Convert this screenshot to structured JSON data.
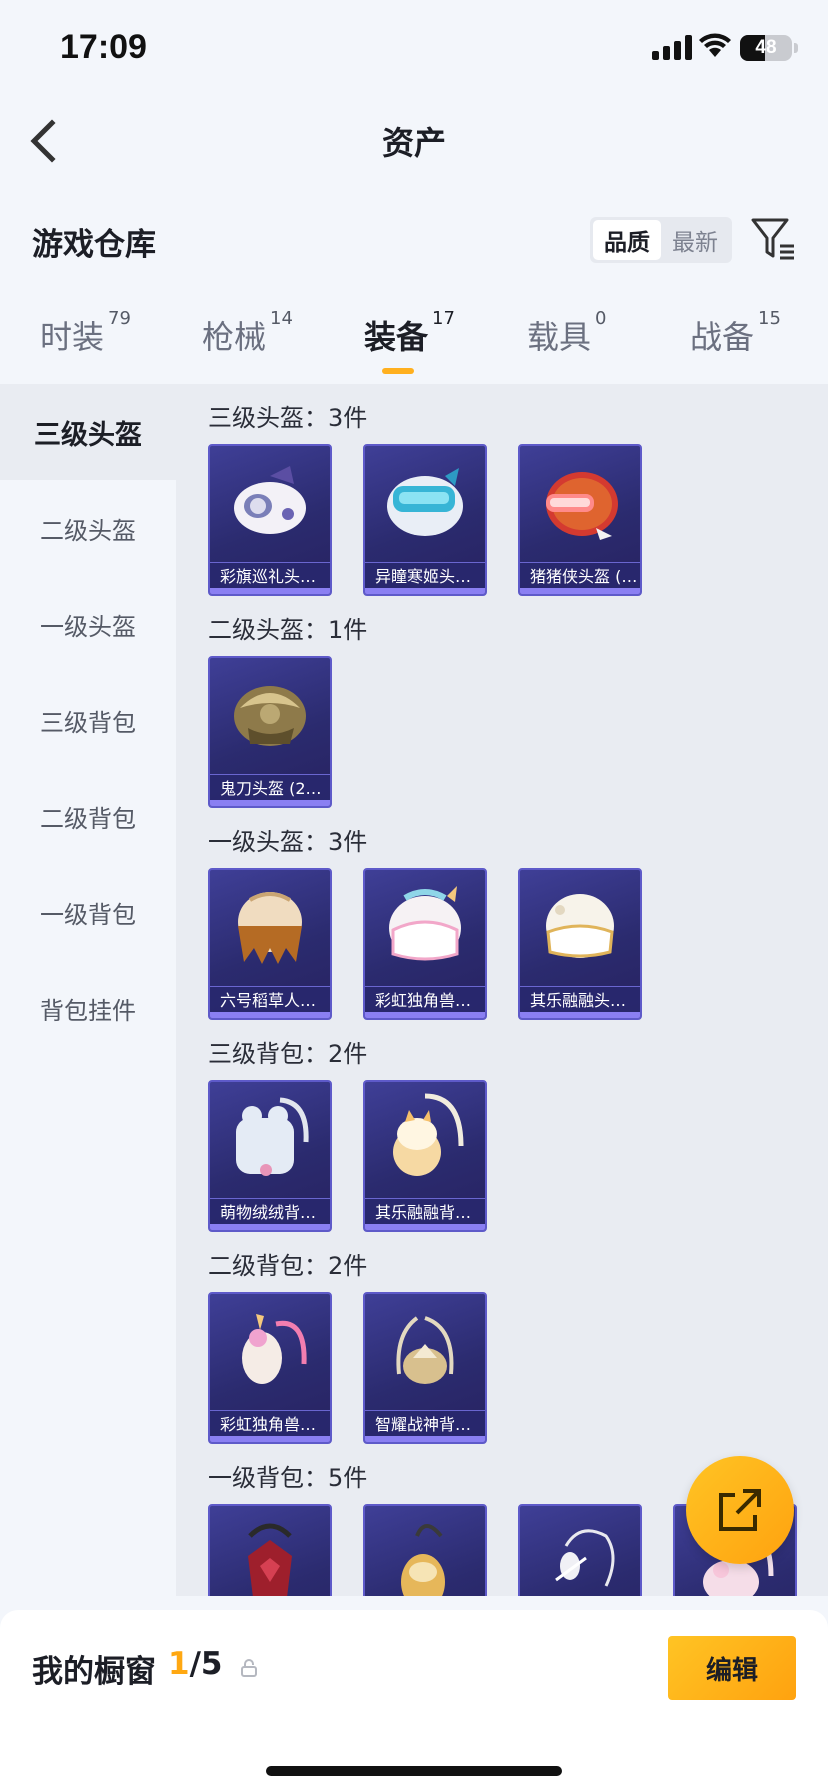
{
  "status_bar": {
    "time": "17:09",
    "battery": "48",
    "battery_level": 0.48
  },
  "header": {
    "title": "资产"
  },
  "warehouse": {
    "title": "游戏仓库",
    "sort_options": [
      "品质",
      "最新"
    ],
    "active_sort": "品质"
  },
  "tabs": [
    {
      "label": "时装",
      "count": "79"
    },
    {
      "label": "枪械",
      "count": "14"
    },
    {
      "label": "装备",
      "count": "17"
    },
    {
      "label": "载具",
      "count": "0"
    },
    {
      "label": "战备",
      "count": "15"
    }
  ],
  "active_tab": "装备",
  "sidebar": {
    "items": [
      "三级头盔",
      "二级头盔",
      "一级头盔",
      "三级背包",
      "二级背包",
      "一级背包",
      "背包挂件"
    ],
    "active": "三级头盔"
  },
  "groups": [
    {
      "title": "三级头盔：3件",
      "items": [
        {
          "name": "彩旗巡礼头…",
          "icon": "cow-helmet-icon"
        },
        {
          "name": "异瞳寒姬头…",
          "icon": "cyber-helmet-icon"
        },
        {
          "name": "猪猪侠头盔 (…",
          "icon": "pig-helmet-icon"
        }
      ]
    },
    {
      "title": "二级头盔：1件",
      "items": [
        {
          "name": "鬼刀头盔 (2…",
          "icon": "gold-helmet-icon"
        }
      ]
    },
    {
      "title": "一级头盔：3件",
      "items": [
        {
          "name": "六号稻草人…",
          "icon": "straw-helmet-icon"
        },
        {
          "name": "彩虹独角兽…",
          "icon": "unicorn-helmet-icon"
        },
        {
          "name": "其乐融融头…",
          "icon": "white-helmet-icon"
        }
      ]
    },
    {
      "title": "三级背包：2件",
      "items": [
        {
          "name": "萌物绒绒背…",
          "icon": "plush-backpack-icon"
        },
        {
          "name": "其乐融融背…",
          "icon": "cat-backpack-icon"
        }
      ]
    },
    {
      "title": "二级背包：2件",
      "items": [
        {
          "name": "彩虹独角兽…",
          "icon": "unicorn-backpack-icon"
        },
        {
          "name": "智耀战神背…",
          "icon": "warrior-backpack-icon"
        }
      ]
    },
    {
      "title": "一级背包：5件",
      "items": [
        {
          "name": "",
          "icon": "red-backpack-icon"
        },
        {
          "name": "",
          "icon": "owl-backpack-icon"
        },
        {
          "name": "",
          "icon": "chain-backpack-icon"
        },
        {
          "name": "",
          "icon": "pink-backpack-icon"
        }
      ]
    }
  ],
  "showcase": {
    "label": "我的橱窗",
    "current": "1",
    "total": "/5",
    "edit_label": "编辑"
  },
  "colors": {
    "accent": "#ffb01f",
    "card_bg": "#2f2f7a",
    "card_border": "#5e5ac9"
  }
}
